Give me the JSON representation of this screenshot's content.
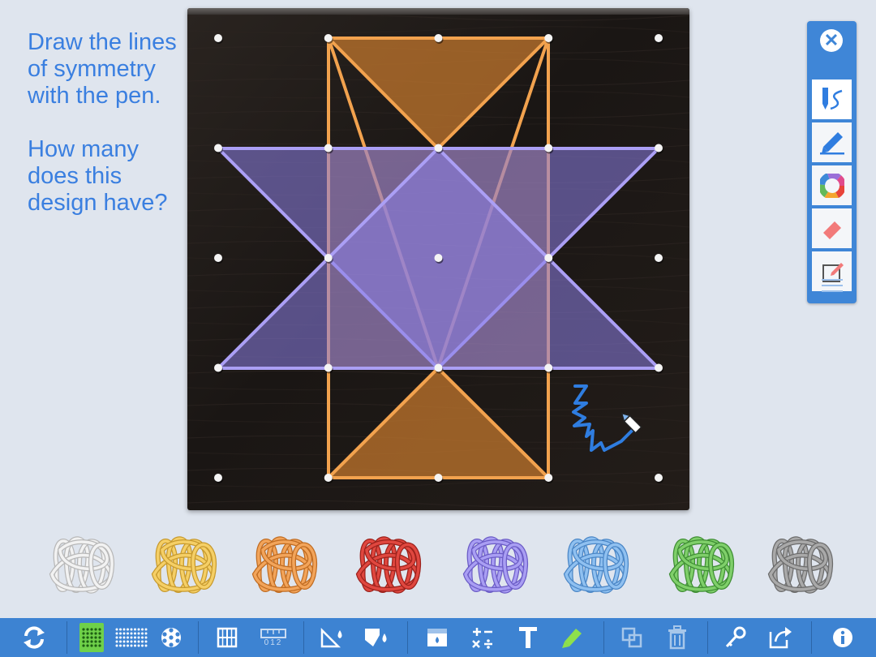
{
  "instructions": {
    "line1": "Draw the lines of symmetry with the pen.",
    "line2": "How many does this design have?"
  },
  "colors": {
    "instruction_text": "#3a7fe0",
    "board": "#1e1a17",
    "orange_band": "#f0a050",
    "purple_band": "#a89cf0",
    "pen_ink": "#2f7de0",
    "toolbar": "#3d83d2"
  },
  "geoboard": {
    "grid_size": 5,
    "orange_star": "two orange triangles forming a six-pointed shape",
    "purple_star": "two purple triangles forming a six-pointed shape"
  },
  "palette": {
    "tools": [
      "pen-tool",
      "highlighter-tool",
      "color-wheel",
      "eraser-tool",
      "notes-tool"
    ],
    "active_tool": "pen-tool"
  },
  "bands": [
    "white",
    "yellow",
    "orange",
    "red",
    "purple",
    "blue",
    "green",
    "gray"
  ],
  "toolbar": {
    "number_label": "012"
  }
}
